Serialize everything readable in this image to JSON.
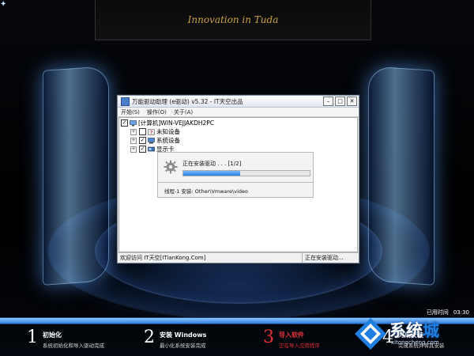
{
  "banner": {
    "text": "Innovation in Tuda"
  },
  "window": {
    "title": "万能驱动助理 (e驱动) v5.32 - IT天空出品",
    "menu": [
      "开始(S)",
      "操作(O)",
      "关于(A)"
    ],
    "tree": {
      "root": "[计算机]WIN-VEJJAKDH2PC",
      "children": [
        "未知设备",
        "系统设备",
        "显示卡"
      ]
    },
    "progress": {
      "text": "正在安装驱动 . . . [1/2]",
      "percent": 45
    },
    "log": {
      "text": "线程-1 安装:   Other\\Vmware\\video"
    },
    "status": {
      "left": "欢迎访问 IT天空[ITianKong.Com]",
      "right": "正在安装驱动..."
    }
  },
  "footer": {
    "elapsed_label": "已用时间",
    "elapsed_value": "03:30",
    "overall_progress": 100,
    "steps": [
      {
        "num": "1",
        "title": "初始化",
        "sub": "系统初始化和导入驱动完成"
      },
      {
        "num": "2",
        "title": "安装 Windows",
        "sub": "最小化系统安装完成"
      },
      {
        "num": "3",
        "title": "导入软件",
        "sub": "正在导入应用程序"
      },
      {
        "num": "4",
        "title": "完成安装",
        "sub": "完成系统并将其安装"
      }
    ]
  },
  "watermark": {
    "text_main": "系统",
    "text_last": "城",
    "url": "xitongcheng.com"
  },
  "colors": {
    "accent": "#e0303a",
    "progress": "#2f7de0",
    "banner_gold": "#c9a24a"
  }
}
